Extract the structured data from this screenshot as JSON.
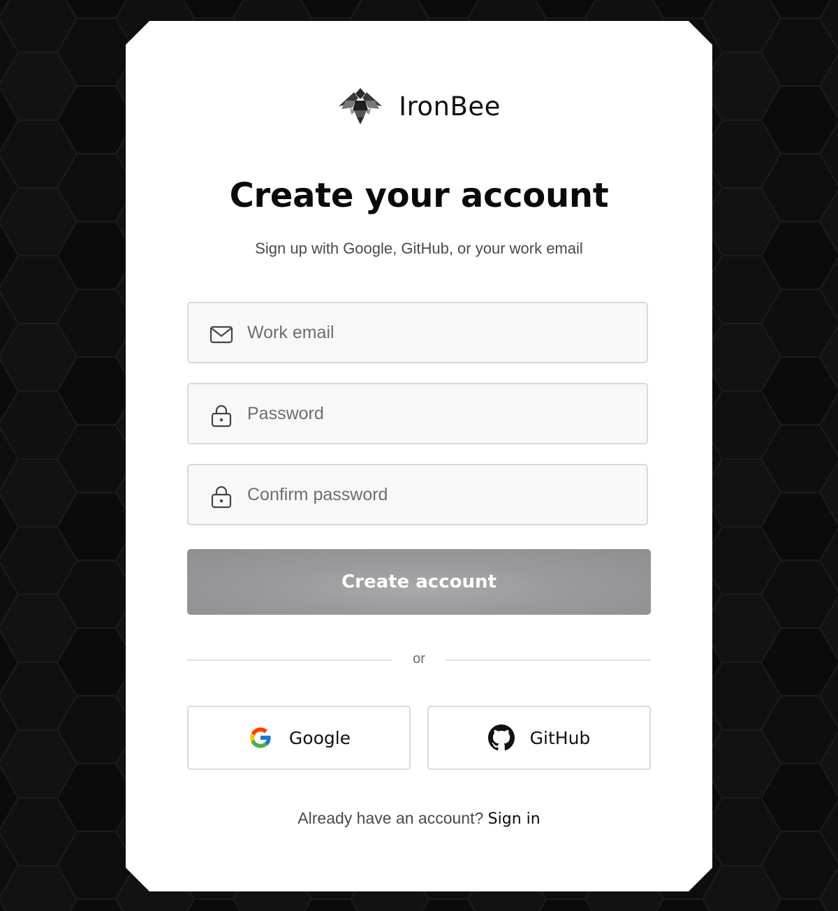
{
  "brand": {
    "name": "IronBee",
    "logo_icon": "bee-logo-icon"
  },
  "header": {
    "title": "Create your account",
    "subtitle": "Sign up with Google, GitHub, or your work email"
  },
  "form": {
    "email": {
      "placeholder": "Work email",
      "value": "",
      "icon": "mail-icon"
    },
    "password": {
      "placeholder": "Password",
      "value": "",
      "icon": "lock-icon"
    },
    "confirm_password": {
      "placeholder": "Confirm password",
      "value": "",
      "icon": "lock-icon"
    },
    "submit_label": "Create account"
  },
  "divider": {
    "label": "or"
  },
  "social": {
    "google": {
      "label": "Google",
      "icon": "google-icon"
    },
    "github": {
      "label": "GitHub",
      "icon": "github-icon"
    }
  },
  "footer": {
    "prompt": "Already have an account?",
    "link_label": "Sign in"
  },
  "colors": {
    "background": "#0b0b0b",
    "card": "#ffffff",
    "primary_button": "#9a9a9c",
    "text": "#0a0a0a",
    "muted": "#4a4a4a"
  }
}
